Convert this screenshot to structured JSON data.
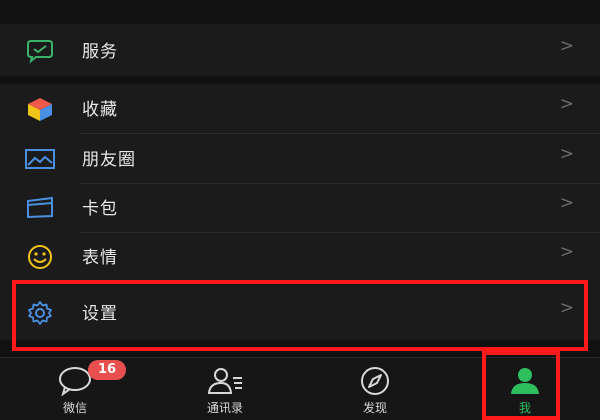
{
  "menu": {
    "service": {
      "label": "服务",
      "icon": "wallet-icon",
      "color": "#3cb36a"
    },
    "favorites": {
      "label": "收藏",
      "icon": "cube-icon"
    },
    "moments": {
      "label": "朋友圈",
      "icon": "photo-icon",
      "color": "#4a90e2"
    },
    "cards": {
      "label": "卡包",
      "icon": "card-icon",
      "color": "#4a90e2"
    },
    "stickers": {
      "label": "表情",
      "icon": "smiley-icon",
      "color": "#f0c419"
    },
    "settings": {
      "label": "设置",
      "icon": "gear-icon",
      "color": "#4a90e2"
    },
    "chevron": ">"
  },
  "tabbar": {
    "chats": {
      "label": "微信",
      "badge": "16",
      "icon": "chat-bubble-icon"
    },
    "contacts": {
      "label": "通讯录",
      "icon": "contacts-icon"
    },
    "discover": {
      "label": "发现",
      "icon": "compass-icon"
    },
    "me": {
      "label": "我",
      "icon": "person-icon",
      "active_color": "#2fbe5e"
    }
  },
  "highlight_color": "#ff1a1a"
}
